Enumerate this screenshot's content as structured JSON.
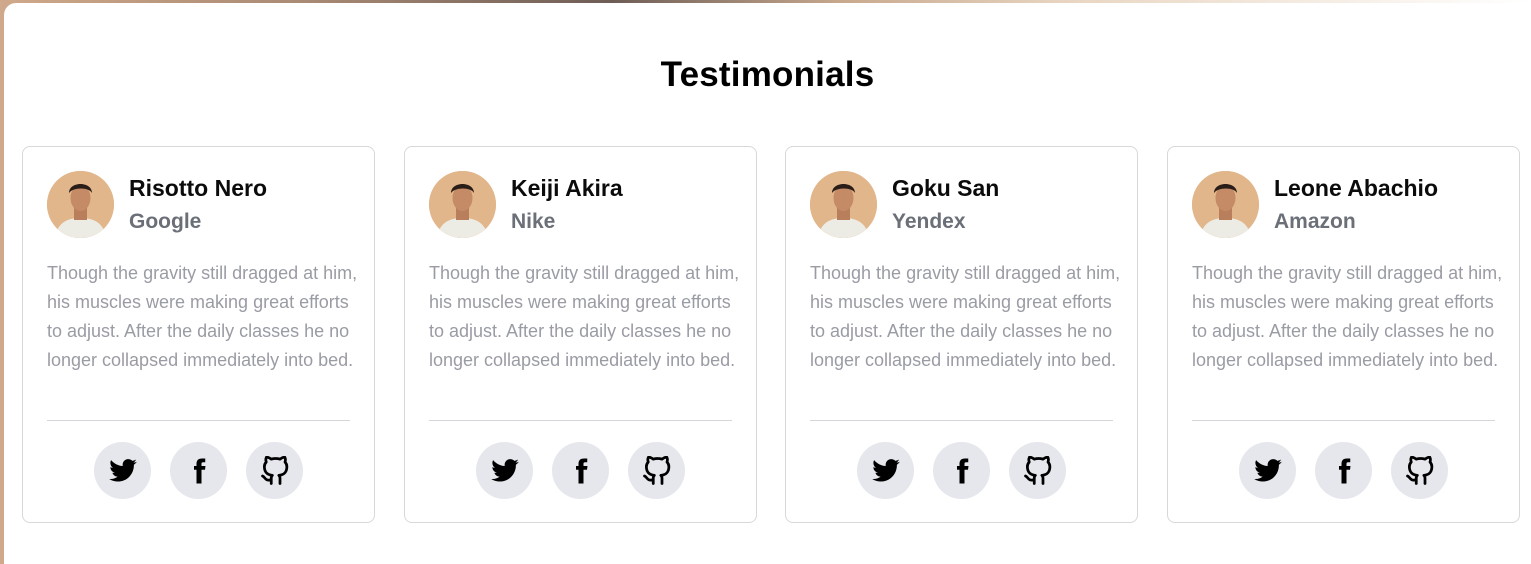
{
  "section": {
    "title": "Testimonials"
  },
  "testimonials": [
    {
      "name": "Risotto Nero",
      "company": "Google",
      "quote": "Though the gravity still dragged at him, his muscles were making great efforts to adjust. After the daily classes he no longer collapsed immediately into bed.",
      "socials": [
        "twitter-icon",
        "facebook-icon",
        "github-icon"
      ]
    },
    {
      "name": "Keiji Akira",
      "company": "Nike",
      "quote": "Though the gravity still dragged at him, his muscles were making great efforts to adjust. After the daily classes he no longer collapsed immediately into bed.",
      "socials": [
        "twitter-icon",
        "facebook-icon",
        "github-icon"
      ]
    },
    {
      "name": "Goku San",
      "company": "Yendex",
      "quote": "Though the gravity still dragged at him, his muscles were making great efforts to adjust. After the daily classes he no longer collapsed immediately into bed.",
      "socials": [
        "twitter-icon",
        "facebook-icon",
        "github-icon"
      ]
    },
    {
      "name": "Leone Abachio",
      "company": "Amazon",
      "quote": "Though the gravity still dragged at him, his muscles were making great efforts to adjust. After the daily classes he no longer collapsed immediately into bed.",
      "socials": [
        "twitter-icon",
        "facebook-icon",
        "github-icon"
      ]
    }
  ],
  "colors": {
    "name_text": "#0b0b0b",
    "company_text": "#6b6f78",
    "quote_text": "#9a9ca4",
    "social_button_bg": "#e6e7ec",
    "card_border": "#d8d8dc"
  }
}
